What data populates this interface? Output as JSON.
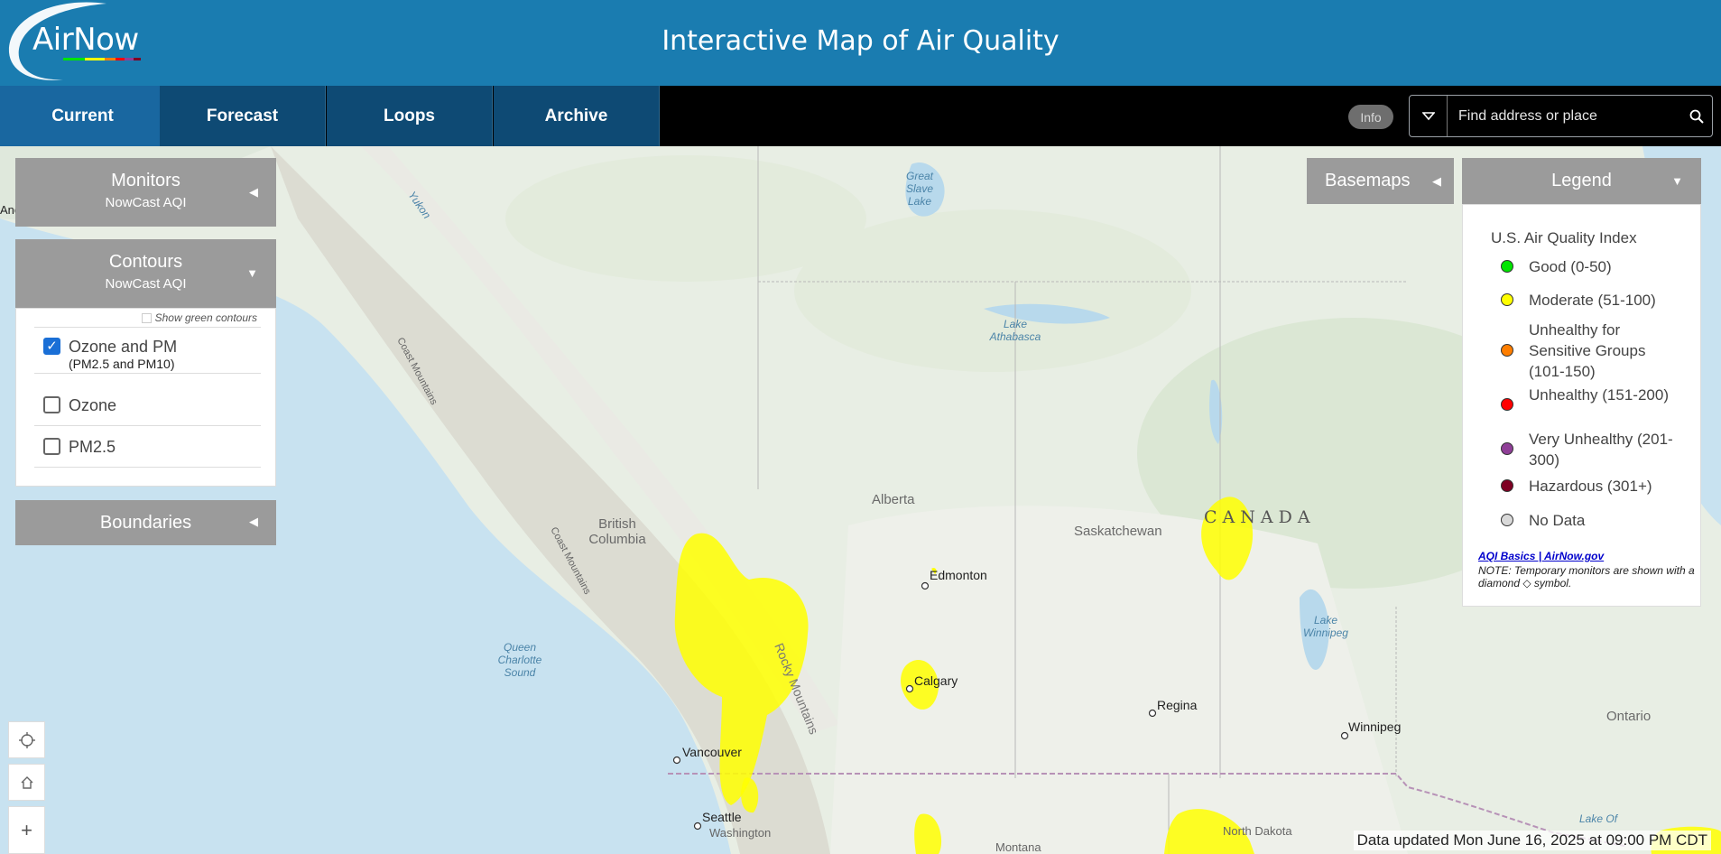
{
  "header": {
    "logo_text": "AirNow",
    "title": "Interactive Map of Air Quality"
  },
  "nav": {
    "tabs": [
      {
        "label": "Current",
        "active": true
      },
      {
        "label": "Forecast",
        "active": false
      },
      {
        "label": "Loops",
        "active": false
      },
      {
        "label": "Archive",
        "active": false
      }
    ],
    "info_label": "Info",
    "search_placeholder": "Find address or place"
  },
  "panels": {
    "monitors": {
      "title": "Monitors",
      "subtitle": "NowCast AQI",
      "expanded": false
    },
    "contours": {
      "title": "Contours",
      "subtitle": "NowCast AQI",
      "expanded": true,
      "show_green_label": "Show green contours",
      "show_green_checked": false,
      "options": [
        {
          "label": "Ozone and PM",
          "sub": "(PM2.5 and PM10)",
          "checked": true
        },
        {
          "label": "Ozone",
          "sub": "",
          "checked": false
        },
        {
          "label": "PM2.5",
          "sub": "",
          "checked": false
        }
      ]
    },
    "boundaries": {
      "title": "Boundaries",
      "expanded": false
    }
  },
  "basemaps": {
    "label": "Basemaps"
  },
  "legend": {
    "label": "Legend",
    "title": "U.S. Air Quality Index",
    "items": [
      {
        "label": "Good (0-50)",
        "color": "#00e400"
      },
      {
        "label": "Moderate (51-100)",
        "color": "#ffff00"
      },
      {
        "label": "Unhealthy for Sensitive Groups (101-150)",
        "color": "#ff7e00"
      },
      {
        "label": "Unhealthy (151-200)",
        "color": "#ff0000"
      },
      {
        "label": "Very Unhealthy (201-300)",
        "color": "#8f3f97"
      },
      {
        "label": "Hazardous (301+)",
        "color": "#7e0023"
      },
      {
        "label": "No Data",
        "color": "#d9d9d9"
      }
    ],
    "link_text": "AQI Basics | AirNow.gov",
    "note": "NOTE: Temporary monitors are shown with a diamond ◇ symbol."
  },
  "map": {
    "labels": {
      "great_slave_lake": "Great Slave Lake",
      "yukon": "Yukon",
      "lake_athabasca": "Lake Athabasca",
      "coast_mountains_1": "Coast Mountains",
      "coast_mountains_2": "Coast Mountains",
      "rocky_mountains": "Rocky Mountains",
      "british_columbia": "British Columbia",
      "alberta": "Alberta",
      "saskatchewan": "Saskatchewan",
      "canada": "CANADA",
      "edmonton": "Edmonton",
      "calgary": "Calgary",
      "regina": "Regina",
      "winnipeg": "Winnipeg",
      "lake_winnipeg": "Lake Winnipeg",
      "queen_charlotte_sound": "Queen Charlotte Sound",
      "vancouver": "Vancouver",
      "seattle": "Seattle",
      "washington": "Washington",
      "montana": "Montana",
      "north_dakota": "North Dakota",
      "ontario": "Ontario",
      "lake_of": "Lake Of",
      "anc": "Anc"
    }
  },
  "status": {
    "updated_text": "Data updated Mon June 16, 2025 at 09:00 PM CDT"
  }
}
